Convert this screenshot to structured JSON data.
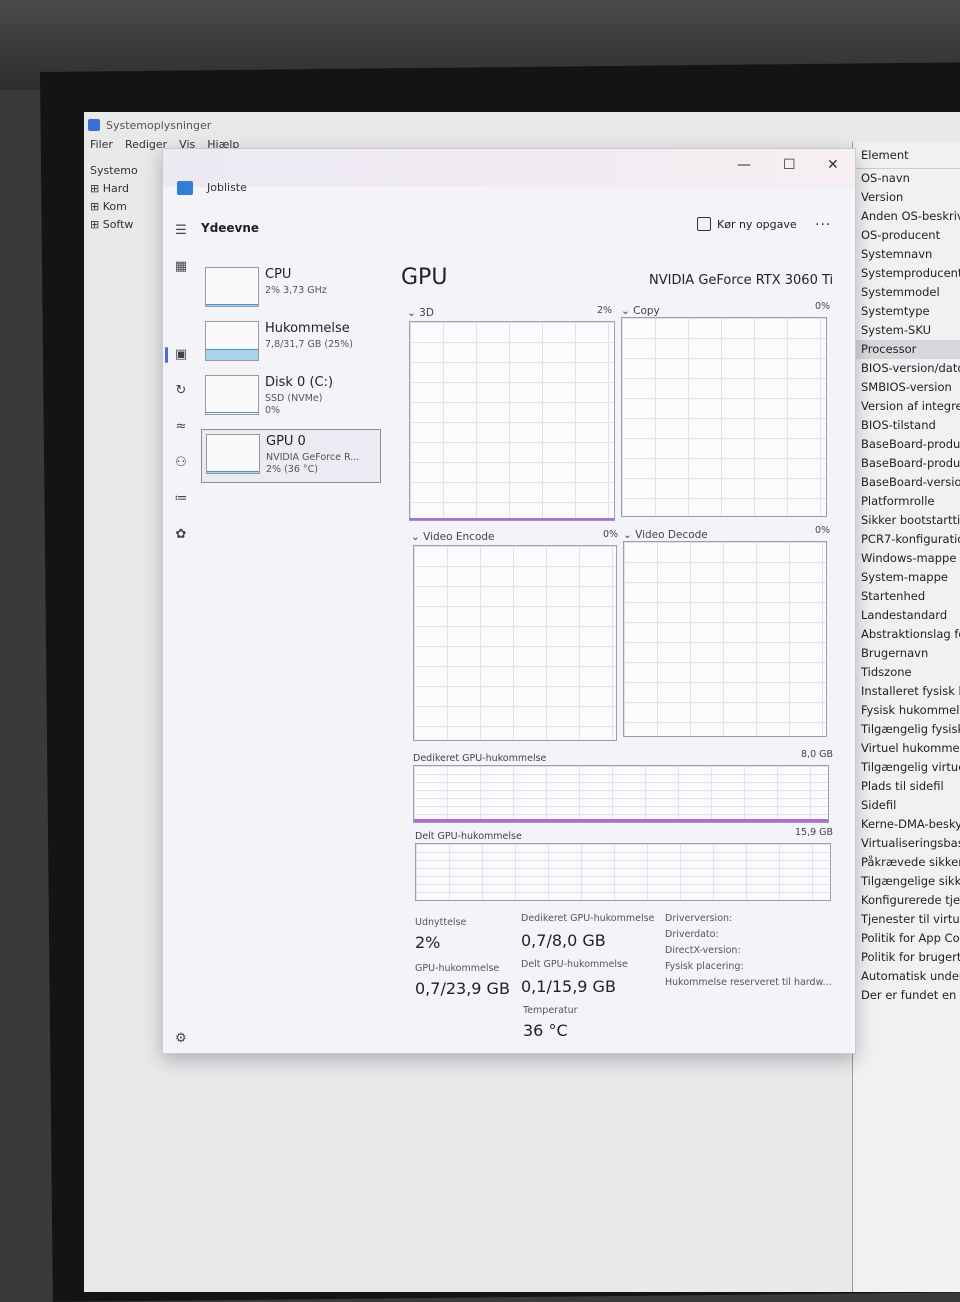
{
  "system_info": {
    "title": "Systemoplysninger",
    "menu": [
      "Filer",
      "Rediger",
      "Vis",
      "Hjælp"
    ],
    "tree": [
      "Systemo",
      "Hard",
      "Kom",
      "Softw"
    ],
    "details_header": "Element",
    "details_items": [
      "OS-navn",
      "Version",
      "Anden OS-beskrive",
      "OS-producent",
      "Systemnavn",
      "Systemproducent",
      "Systemmodel",
      "Systemtype",
      "System-SKU",
      "Processor",
      "BIOS-version/dato",
      "SMBIOS-version",
      "Version af integrer",
      "BIOS-tilstand",
      "BaseBoard-produc",
      "BaseBoard-produk",
      "BaseBoard-version",
      "Platformrolle",
      "Sikker bootstarttils",
      "PCR7-konfiguration",
      "Windows-mappe",
      "System-mappe",
      "Startenhed",
      "Landestandard",
      "Abstraktionslag fo",
      "Brugernavn",
      "Tidszone",
      "Installeret fysisk hu",
      "Fysisk hukommelse",
      "Tilgængelig fysisk",
      "Virtuel hukommels",
      "Tilgængelig virtuel",
      "Plads til sidefil",
      "Sidefil",
      "Kerne-DMA-besky",
      "Virtualiseringsbase",
      "Påkrævede sikkerh",
      "Tilgængelige sikke",
      "Konfigurerede tjer",
      "Tjenester til virtual",
      "Politik for App Cor",
      "Politik for brugerti",
      "Automatisk unders",
      "Der er fundet en h"
    ]
  },
  "task_manager": {
    "title": "Jobliste",
    "section_title": "Ydeevne",
    "run_task_label": "Kør ny opgave",
    "more_label": "...",
    "window_controls": {
      "minimize": "—",
      "maximize": "☐",
      "close": "✕"
    },
    "devices": [
      {
        "name": "CPU",
        "sub": "2% 3,73 GHz",
        "sub2": "",
        "fill": 0.02
      },
      {
        "name": "Hukommelse",
        "sub": "7,8/31,7 GB (25%)",
        "sub2": "",
        "fill": 0.25
      },
      {
        "name": "Disk 0 (C:)",
        "sub": "SSD (NVMe)",
        "sub2": "0%",
        "fill": 0
      },
      {
        "name": "GPU 0",
        "sub": "NVIDIA GeForce R...",
        "sub2": "2% (36 °C)",
        "fill": 0.02
      }
    ],
    "gpu": {
      "title": "GPU",
      "model": "NVIDIA GeForce RTX 3060 Ti",
      "engines": [
        {
          "label": "3D",
          "pct": "2%",
          "value": 0.02
        },
        {
          "label": "Copy",
          "pct": "0%",
          "value": 0
        },
        {
          "label": "Video Encode",
          "pct": "0%",
          "value": 0
        },
        {
          "label": "Video Decode",
          "pct": "0%",
          "value": 0
        }
      ],
      "dedicated_label": "Dedikeret GPU-hukommelse",
      "dedicated_max": "8,0 GB",
      "shared_label": "Delt GPU-hukommelse",
      "shared_max": "15,9 GB",
      "stats": {
        "util_label": "Udnyttelse",
        "util_value": "2%",
        "gpu_mem_label": "GPU-hukommelse",
        "gpu_mem_value": "0,7/23,9 GB",
        "ded_label": "Dedikeret GPU-hukommelse",
        "ded_value": "0,7/8,0 GB",
        "shared_label": "Delt GPU-hukommelse",
        "shared_value": "0,1/15,9 GB",
        "temp_label": "Temperatur",
        "temp_value": "36 °C"
      },
      "info": [
        "Driverversion:",
        "Driverdato:",
        "DirectX-version:",
        "Fysisk placering:",
        "Hukommelse reserveret til hardw..."
      ]
    }
  }
}
